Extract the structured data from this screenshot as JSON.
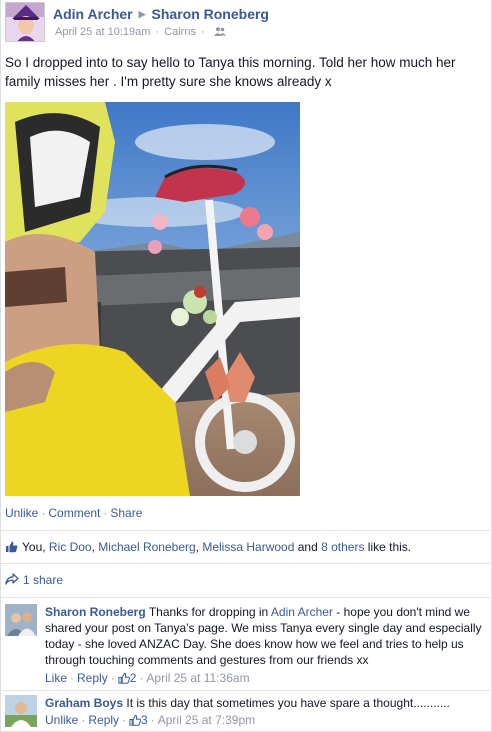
{
  "post": {
    "author": "Adin Archer",
    "target": "Sharon Roneberg",
    "timestamp": "April 25 at 10:19am",
    "location": "Cairns",
    "audience_icon": "friends-icon",
    "text": "So I dropped into to say hello to Tanya this morning. Told her how much her family misses her . I'm pretty sure she knows already x",
    "actions": {
      "unlike": "Unlike",
      "comment": "Comment",
      "share": "Share"
    }
  },
  "likes": {
    "prefix": "You, ",
    "people": [
      "Ric Doo",
      "Michael Roneberg",
      "Melissa Harwood"
    ],
    "and": " and ",
    "others": "8 others",
    "suffix": " like this."
  },
  "shares": {
    "label": "1 share"
  },
  "comments": [
    {
      "author": "Sharon Roneberg",
      "text_before": "Thanks for dropping in ",
      "mention": "Adin Archer",
      "text_after": " - hope you don't mind we shared your post on Tanya's page. We miss Tanya every single day and especially today - she loved ANZAC Day. She does know how we feel and tries to help us through touching comments and gestures from our friends xx",
      "like_label": "Like",
      "reply_label": "Reply",
      "like_count": "2",
      "timestamp": "April 25 at 11:36am"
    },
    {
      "author": "Graham Boys",
      "text": "It is this day that sometimes you have spare a thought...........",
      "like_label": "Unlike",
      "reply_label": "Reply",
      "like_count": "3",
      "timestamp": "April 25 at 7:39pm"
    }
  ],
  "colors": {
    "link": "#3b5998",
    "meta": "#9197a3",
    "text": "#141823"
  }
}
